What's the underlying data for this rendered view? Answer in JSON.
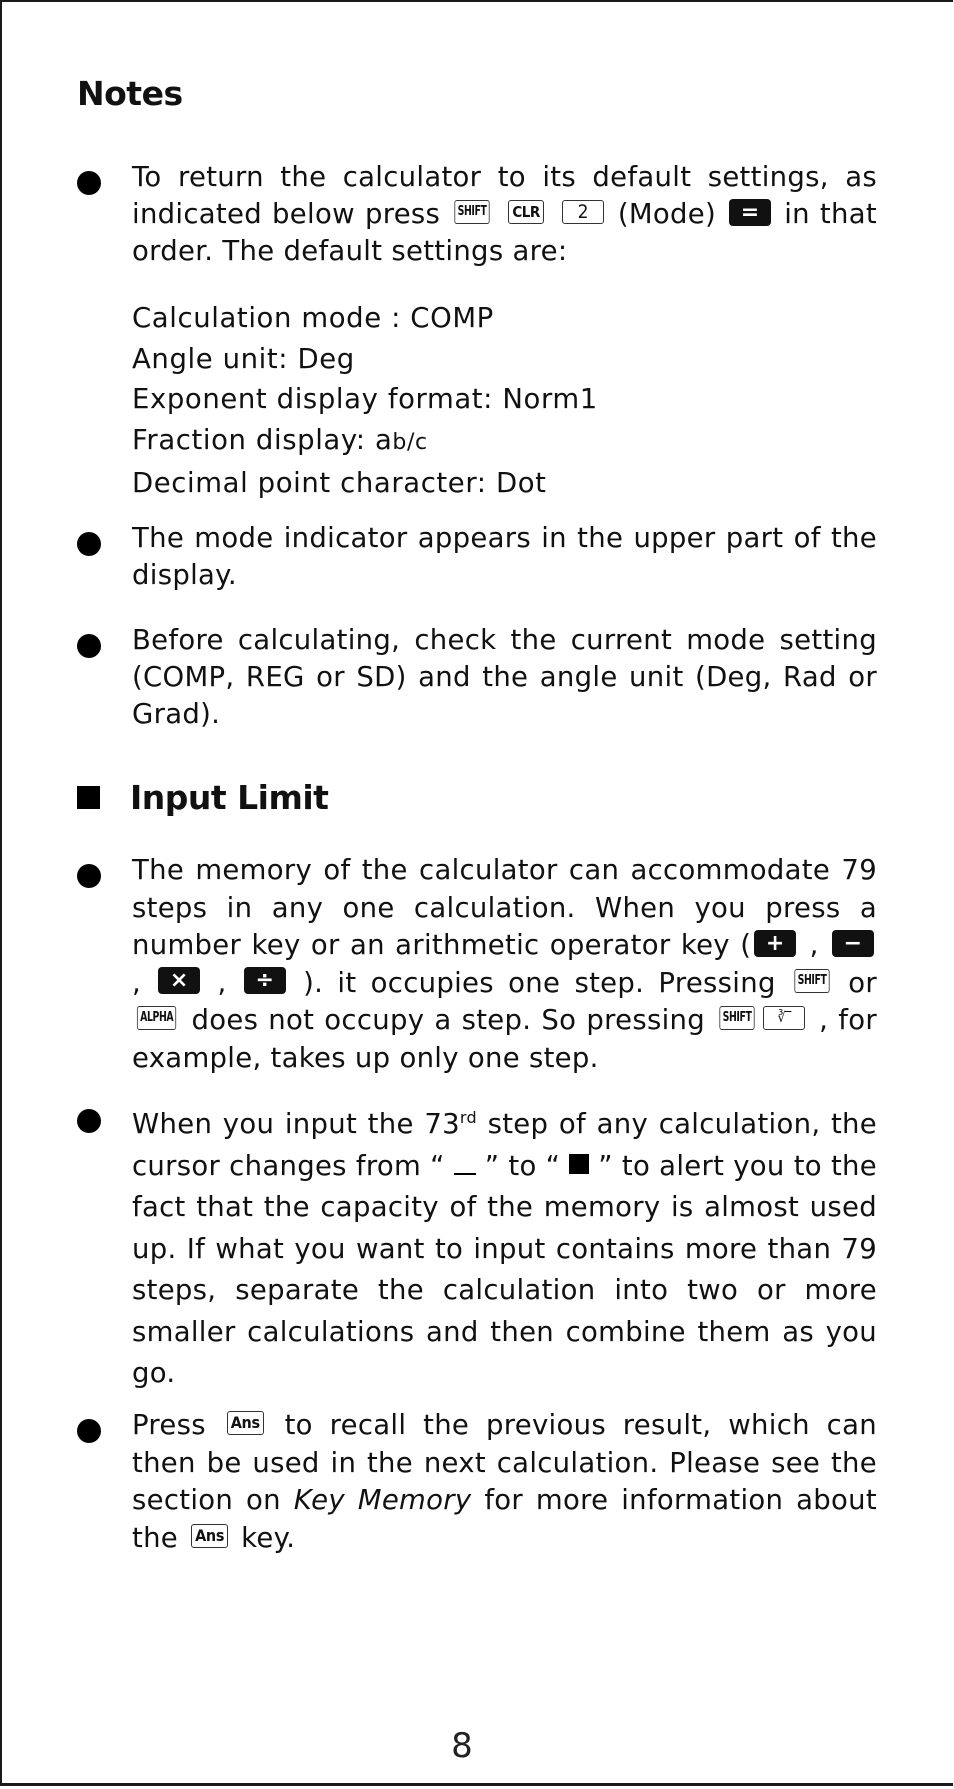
{
  "page": {
    "title": "Notes",
    "page_number": "8"
  },
  "notes": {
    "item1": {
      "part1": "To return the calculator to its default settings, as indicated below press",
      "key_shift": "SHIFT",
      "key_clr": "CLR",
      "key_2": "2",
      "mode_label": "(Mode)",
      "key_equals": "=",
      "part2": "in  that order. The default settings are:"
    },
    "defaults": [
      {
        "label": "Calculation mode : ",
        "value": "COMP"
      },
      {
        "label": "Angle unit:  ",
        "value": "Deg"
      },
      {
        "label": "Exponent display format: ",
        "value": "Norm1"
      },
      {
        "label": "Fraction display:  ",
        "value": "a",
        "value_sup": "b/c"
      },
      {
        "label": "Decimal point character: ",
        "value": "Dot"
      }
    ],
    "item2": "The mode indicator appears in the upper part of the display.",
    "item3": "Before calculating, check the current mode setting (COMP, REG or SD) and the angle unit (Deg, Rad or Grad)."
  },
  "input_limit": {
    "heading": "Input Limit",
    "item1": {
      "part1": "The memory of the calculator can accommodate 79 steps in any one calculation. When you press a  number key or an arithmetic operator key (",
      "key_plus": "+",
      "sep1": " , ",
      "key_minus": "−",
      "sep2": " , ",
      "key_times": "×",
      "sep3": " , ",
      "key_divide": "÷",
      "part2": " ). it  occupies  one  step.  Pressing ",
      "key_shift": "SHIFT",
      "or": " or ",
      "key_alpha": "ALPHA",
      "part3": " does  not  occupy  a  step.  So  pressing ",
      "key_shift2": "SHIFT",
      "key_cuberoot": "∛‾",
      "part4": " ,  for example,  takes up only one step."
    },
    "item2": {
      "part1": "When you input the 73",
      "sup": "rd",
      "part2": "  step of any calculation, the cursor changes from “ ",
      "part3": " ” to “ ",
      "part4": " ” to alert you to the fact that the capacity of the memory is almost used up. If what you want to input contains more than 79 steps, separate the calculation into two or more smaller calculations and then combine them as you go."
    },
    "item3": {
      "part1": "Press ",
      "key_ans": "Ans",
      "part2": "  to recall the previous result, which can then be used in the next calculation. Please see the section on ",
      "emphasis": "Key Memory",
      "part3": " for more information about the ",
      "key_ans2": "Ans",
      "part4": "  key."
    }
  }
}
